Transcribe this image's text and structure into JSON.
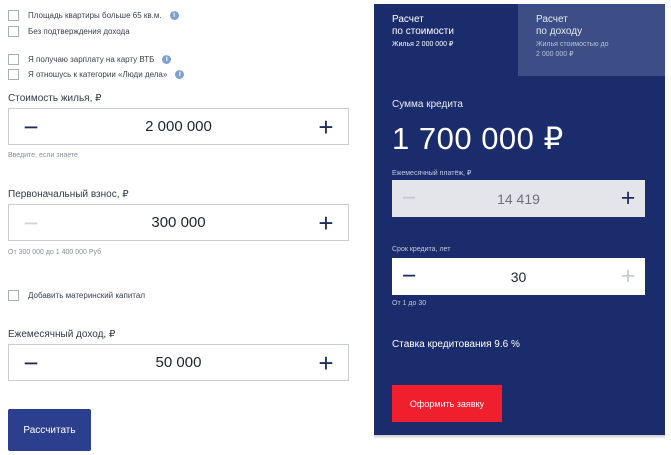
{
  "checkboxes_top": [
    {
      "label": "Площадь квартиры больше 65 кв.м.",
      "has_info": true
    },
    {
      "label": "Без подтверждения дохода",
      "has_info": false
    }
  ],
  "checkboxes_mid": [
    {
      "label": "Я получаю зарплату на карту ВТБ",
      "has_info": true
    },
    {
      "label": "Я отношусь к категории «Люди дела»",
      "has_info": true
    }
  ],
  "info_glyph": "i",
  "property_cost": {
    "label": "Стоимость жилья, ₽",
    "value": "2 000 000",
    "hint": "Введите, если знаете"
  },
  "down_payment": {
    "label": "Первоначальный взнос, ₽",
    "value": "300 000",
    "hint": "От 300 000 до 1 400 000 Руб"
  },
  "maternity_capital": {
    "label": "Добавить материнский капитал"
  },
  "monthly_income": {
    "label": "Ежемесячный доход, ₽",
    "value": "50 000"
  },
  "calculate_button": "Рассчитать",
  "stepper_minus": "−",
  "stepper_plus": "+",
  "panel": {
    "tabs": [
      {
        "title_line1": "Расчет",
        "title_line2": "по стоимости",
        "sub_line1": "Жилья 2 000 000 ₽",
        "sub_line2": ""
      },
      {
        "title_line1": "Расчет",
        "title_line2": "по доходу",
        "sub_line1": "Жилья стоимостью до",
        "sub_line2": "2 000 000 ₽"
      }
    ],
    "loan_sum_label": "Сумма кредита",
    "loan_sum_value": "1 700 000 ₽",
    "monthly_payment": {
      "label": "Ежемесячный платёж, ₽",
      "value": "14 419"
    },
    "loan_term": {
      "label": "Срок кредита, лет",
      "value": "30",
      "hint": "От 1 до 30"
    },
    "rate_text": "Ставка кредитования 9.6 %",
    "apply_button": "Оформить заявку"
  },
  "colors": {
    "panel_bg": "#1b2c6c",
    "inactive_tab_bg": "#3d4e87",
    "primary_button": "#2c3f8e",
    "accent_red": "#ef1f2d",
    "stepper_icon": "#1d2d5b"
  },
  "icons": [
    "info-icon",
    "minus-icon",
    "plus-icon",
    "checkbox-icon"
  ]
}
